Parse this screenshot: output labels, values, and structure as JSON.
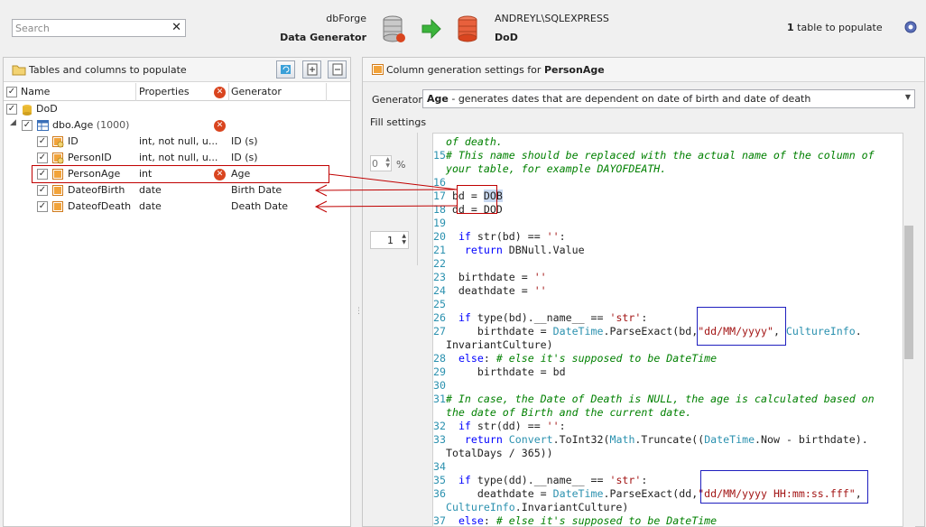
{
  "search": {
    "placeholder": "Search"
  },
  "header": {
    "brand_line1": "dbForge",
    "brand_line2": "Data Generator",
    "server": "ANDREYL\\SQLEXPRESS",
    "database": "DoD",
    "populate_count": "1",
    "populate_text": " table to populate"
  },
  "left": {
    "title": "Tables and columns to populate",
    "columns": [
      "Name",
      "Properties",
      "Generator"
    ],
    "rows": [
      {
        "name": "DoD",
        "props": "",
        "gen": ""
      },
      {
        "name": "dbo.Age",
        "count": "(1000)",
        "props": "",
        "gen": ""
      },
      {
        "name": "ID",
        "props": "int, not null, u...",
        "gen": "ID (s)"
      },
      {
        "name": "PersonID",
        "props": "int, not null, u...",
        "gen": "ID (s)"
      },
      {
        "name": "PersonAge",
        "props": "int",
        "gen": "Age"
      },
      {
        "name": "DateofBirth",
        "props": "date",
        "gen": "Birth Date"
      },
      {
        "name": "DateofDeath",
        "props": "date",
        "gen": "Death Date"
      }
    ]
  },
  "right": {
    "title_prefix": "Column generation settings for ",
    "title_column": "PersonAge",
    "generator_label": "Generator:",
    "generator_name": "Age",
    "generator_desc": " - generates dates that are dependent on date of birth and date of death",
    "fill_label": "Fill settings",
    "percent_value": "0",
    "percent_sign": "%",
    "seed_value": "1"
  },
  "code_lines": [
    {
      "n": "",
      "parts": [
        {
          "t": "of death.",
          "c": "cm"
        }
      ]
    },
    {
      "n": "15",
      "parts": [
        {
          "t": "# This name should be replaced with the actual name of the column of",
          "c": "cm"
        }
      ]
    },
    {
      "n": "",
      "parts": [
        {
          "t": "your table, for example DAYOFDEATH.",
          "c": "cm"
        }
      ]
    },
    {
      "n": "16",
      "parts": []
    },
    {
      "n": "17",
      "parts": [
        {
          "t": " bd = ",
          "c": ""
        },
        {
          "t": "DOB",
          "c": "hl"
        }
      ]
    },
    {
      "n": "18",
      "parts": [
        {
          "t": " dd = DOD",
          "c": ""
        }
      ]
    },
    {
      "n": "19",
      "parts": []
    },
    {
      "n": "20",
      "parts": [
        {
          "t": "  ",
          "c": ""
        },
        {
          "t": "if",
          "c": "kw"
        },
        {
          "t": " str(bd) == ",
          "c": ""
        },
        {
          "t": "''",
          "c": "st"
        },
        {
          "t": ":",
          "c": ""
        }
      ]
    },
    {
      "n": "21",
      "parts": [
        {
          "t": "   ",
          "c": ""
        },
        {
          "t": "return",
          "c": "kw"
        },
        {
          "t": " DBNull.Value",
          "c": ""
        }
      ]
    },
    {
      "n": "22",
      "parts": []
    },
    {
      "n": "23",
      "parts": [
        {
          "t": "  birthdate = ",
          "c": ""
        },
        {
          "t": "''",
          "c": "st"
        }
      ]
    },
    {
      "n": "24",
      "parts": [
        {
          "t": "  deathdate = ",
          "c": ""
        },
        {
          "t": "''",
          "c": "st"
        }
      ]
    },
    {
      "n": "25",
      "parts": []
    },
    {
      "n": "26",
      "parts": [
        {
          "t": "  ",
          "c": ""
        },
        {
          "t": "if",
          "c": "kw"
        },
        {
          "t": " type(bd).__name__ == ",
          "c": ""
        },
        {
          "t": "'str'",
          "c": "st"
        },
        {
          "t": ":",
          "c": ""
        }
      ]
    },
    {
      "n": "27",
      "parts": [
        {
          "t": "     birthdate = ",
          "c": ""
        },
        {
          "t": "DateTime",
          "c": "ty"
        },
        {
          "t": ".ParseExact(bd,",
          "c": ""
        },
        {
          "t": "\"dd/MM/yyyy\"",
          "c": "st"
        },
        {
          "t": ", ",
          "c": ""
        },
        {
          "t": "CultureInfo",
          "c": "ty"
        },
        {
          "t": ".",
          "c": ""
        }
      ]
    },
    {
      "n": "",
      "parts": [
        {
          "t": "InvariantCulture)",
          "c": ""
        }
      ]
    },
    {
      "n": "28",
      "parts": [
        {
          "t": "  ",
          "c": ""
        },
        {
          "t": "else",
          "c": "kw"
        },
        {
          "t": ": ",
          "c": ""
        },
        {
          "t": "# else it's supposed to be DateTime",
          "c": "cm"
        }
      ]
    },
    {
      "n": "29",
      "parts": [
        {
          "t": "     birthdate = bd",
          "c": ""
        }
      ]
    },
    {
      "n": "30",
      "parts": []
    },
    {
      "n": "31",
      "parts": [
        {
          "t": "# In case, the Date of Death is NULL, the age is calculated based on",
          "c": "cm"
        }
      ]
    },
    {
      "n": "",
      "parts": [
        {
          "t": "the date of Birth and the current date.",
          "c": "cm"
        }
      ]
    },
    {
      "n": "32",
      "parts": [
        {
          "t": "  ",
          "c": ""
        },
        {
          "t": "if",
          "c": "kw"
        },
        {
          "t": " str(dd) == ",
          "c": ""
        },
        {
          "t": "''",
          "c": "st"
        },
        {
          "t": ":",
          "c": ""
        }
      ]
    },
    {
      "n": "33",
      "parts": [
        {
          "t": "   ",
          "c": ""
        },
        {
          "t": "return",
          "c": "kw"
        },
        {
          "t": " ",
          "c": ""
        },
        {
          "t": "Convert",
          "c": "ty"
        },
        {
          "t": ".ToInt32(",
          "c": ""
        },
        {
          "t": "Math",
          "c": "ty"
        },
        {
          "t": ".Truncate((",
          "c": ""
        },
        {
          "t": "DateTime",
          "c": "ty"
        },
        {
          "t": ".Now - birthdate).",
          "c": ""
        }
      ]
    },
    {
      "n": "",
      "parts": [
        {
          "t": "TotalDays / 365))",
          "c": ""
        }
      ]
    },
    {
      "n": "34",
      "parts": []
    },
    {
      "n": "35",
      "parts": [
        {
          "t": "  ",
          "c": ""
        },
        {
          "t": "if",
          "c": "kw"
        },
        {
          "t": " type(dd).__name__ == ",
          "c": ""
        },
        {
          "t": "'str'",
          "c": "st"
        },
        {
          "t": ":",
          "c": ""
        }
      ]
    },
    {
      "n": "36",
      "parts": [
        {
          "t": "     deathdate = ",
          "c": ""
        },
        {
          "t": "DateTime",
          "c": "ty"
        },
        {
          "t": ".ParseExact(dd,",
          "c": ""
        },
        {
          "t": "\"dd/MM/yyyy HH:mm:ss.fff\"",
          "c": "st"
        },
        {
          "t": ",",
          "c": ""
        }
      ]
    },
    {
      "n": "",
      "parts": [
        {
          "t": "CultureInfo",
          "c": "ty"
        },
        {
          "t": ".InvariantCulture)",
          "c": ""
        }
      ]
    },
    {
      "n": "37",
      "parts": [
        {
          "t": "  ",
          "c": ""
        },
        {
          "t": "else",
          "c": "kw"
        },
        {
          "t": ": ",
          "c": ""
        },
        {
          "t": "# else it's supposed to be DateTime",
          "c": "cm"
        }
      ]
    }
  ],
  "colors": {
    "accent_red": "#c00000",
    "accent_blue": "#1f1fbf",
    "error_icon": "#d9451f"
  }
}
